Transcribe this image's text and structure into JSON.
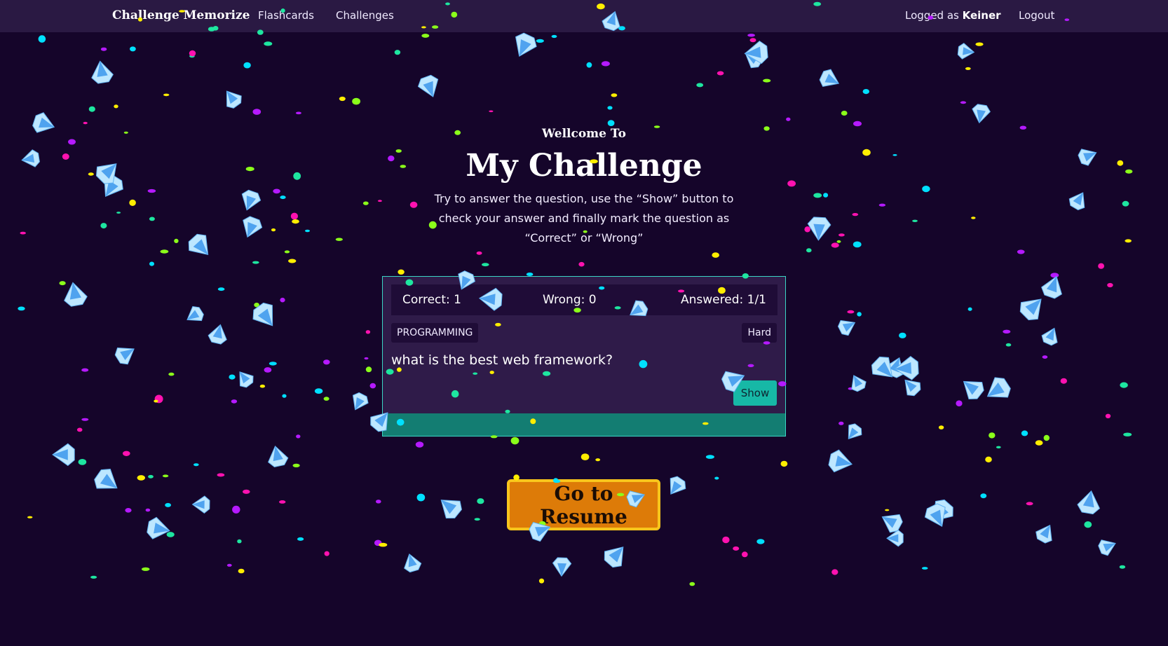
{
  "nav": {
    "brand": "Challenge Memorize",
    "links": [
      "Flashcards",
      "Challenges"
    ],
    "logged_prefix": "Logged as",
    "username": "Keiner",
    "logout": "Logout"
  },
  "hero": {
    "welcome": "Wellcome To",
    "title": "My Challenge",
    "subtitle": "Try to answer the question, use the “Show” button to check your answer and finally mark the question as “Correct” or “Wrong”"
  },
  "card": {
    "correct": "Correct: 1",
    "wrong": "Wrong: 0",
    "answered": "Answered: 1/1",
    "category": "PROGRAMMING",
    "difficulty": "Hard",
    "question": "what is the best web framework?",
    "show_label": "Show"
  },
  "resume_label": "Go to Resume",
  "colors": {
    "background": "#15052a",
    "navbar": "#2a1943",
    "card_border": "#3ad6c4",
    "card_footer": "#137d72",
    "show_button": "#17b8a6",
    "resume_button": "#dd7b08",
    "resume_border": "#f8c51c",
    "confetti": [
      "#ff12b0",
      "#ffee00",
      "#00e0ff",
      "#8bff1a",
      "#b51aff",
      "#1ee6a0"
    ]
  },
  "decoration": {
    "confetti_icon": "confetti-dot-icon",
    "gem_icon": "diamond-icon"
  }
}
